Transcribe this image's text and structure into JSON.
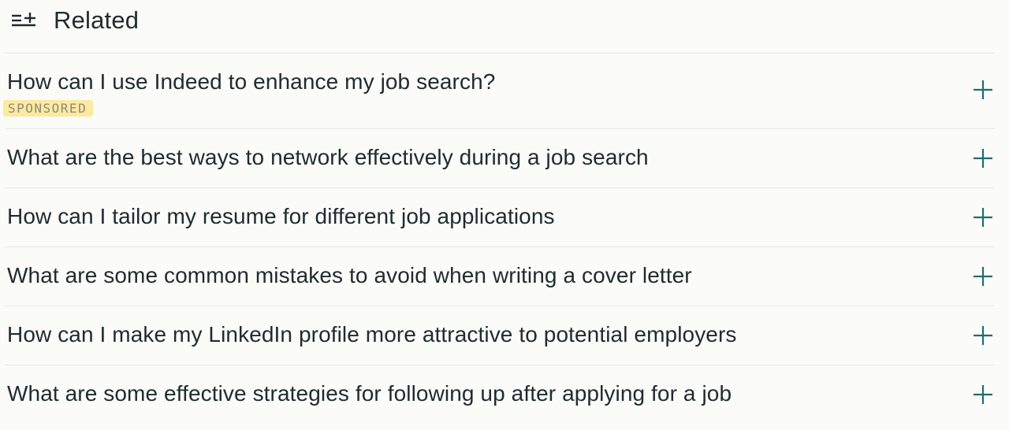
{
  "header": {
    "title": "Related",
    "icon": "related-list-icon"
  },
  "questions": [
    {
      "text": "How can I use Indeed to enhance my job search?",
      "badge": "SPONSORED"
    },
    {
      "text": "What are the best ways to network effectively during a job search"
    },
    {
      "text": "How can I tailor my resume for different job applications"
    },
    {
      "text": "What are some common mistakes to avoid when writing a cover letter"
    },
    {
      "text": "How can I make my LinkedIn profile more attractive to potential employers"
    },
    {
      "text": "What are some effective strategies for following up after applying for a job"
    }
  ],
  "colors": {
    "background": "#fbfbf9",
    "text": "#1f2b2d",
    "accent": "#1f6e6b",
    "sponsored_bg": "#fbeaa0",
    "divider": "#e6e6e2"
  }
}
